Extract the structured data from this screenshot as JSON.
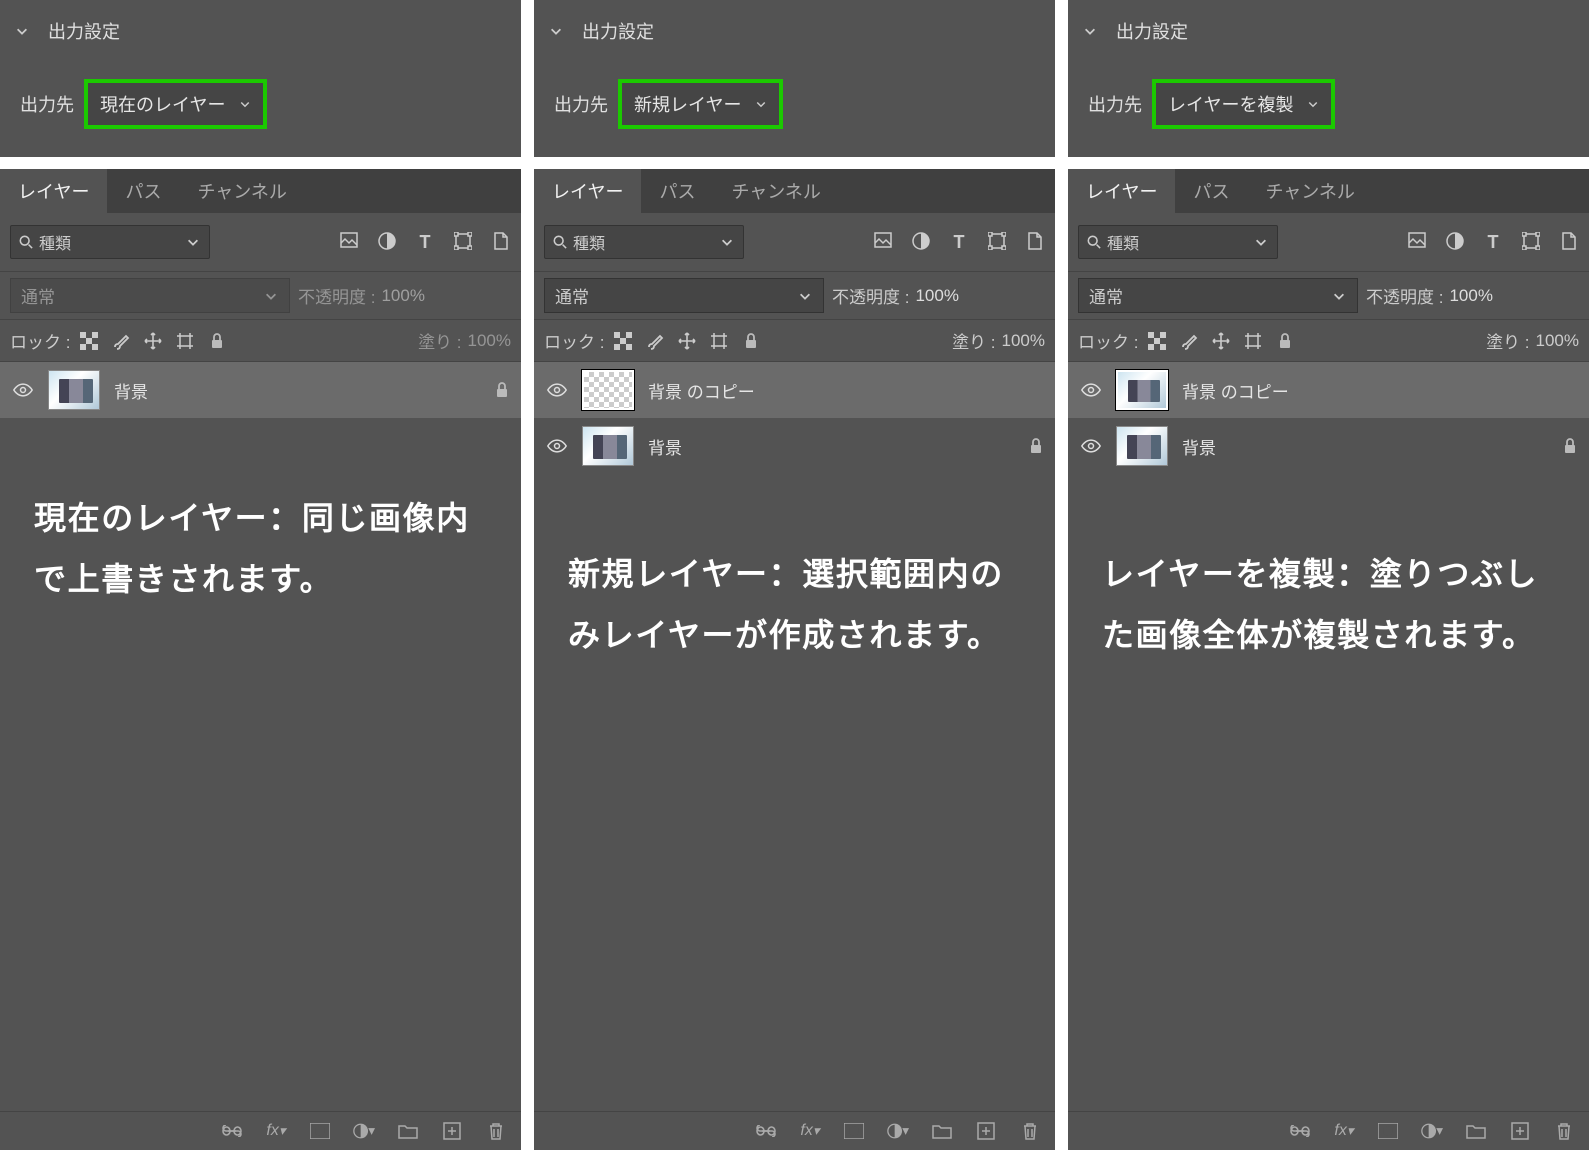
{
  "columns": [
    {
      "section_title": "出力設定",
      "output_label": "出力先",
      "output_value": "現在のレイヤー",
      "tabs": {
        "layers": "レイヤー",
        "paths": "パス",
        "channels": "チャンネル"
      },
      "filter_label": "種類",
      "blend_mode": "通常",
      "blend_disabled": true,
      "opacity_label": "不透明度 :",
      "opacity_value": "100%",
      "opacity_disabled": true,
      "lock_label": "ロック :",
      "fill_label": "塗り :",
      "fill_value": "100%",
      "fill_disabled": true,
      "layers_list": [
        {
          "name": "背景",
          "selected": true,
          "thumb": "img",
          "bracket": false,
          "locked": true
        }
      ],
      "description": "現在のレイヤー：同じ画像内で上書きされます。"
    },
    {
      "section_title": "出力設定",
      "output_label": "出力先",
      "output_value": "新規レイヤー",
      "tabs": {
        "layers": "レイヤー",
        "paths": "パス",
        "channels": "チャンネル"
      },
      "filter_label": "種類",
      "blend_mode": "通常",
      "blend_disabled": false,
      "opacity_label": "不透明度 :",
      "opacity_value": "100%",
      "opacity_disabled": false,
      "lock_label": "ロック :",
      "fill_label": "塗り :",
      "fill_value": "100%",
      "fill_disabled": false,
      "layers_list": [
        {
          "name": "背景 のコピー",
          "selected": true,
          "thumb": "trans",
          "bracket": true,
          "locked": false
        },
        {
          "name": "背景",
          "selected": false,
          "thumb": "img",
          "bracket": false,
          "locked": true
        }
      ],
      "description": "新規レイヤー：選択範囲内のみレイヤーが作成されます。"
    },
    {
      "section_title": "出力設定",
      "output_label": "出力先",
      "output_value": "レイヤーを複製",
      "tabs": {
        "layers": "レイヤー",
        "paths": "パス",
        "channels": "チャンネル"
      },
      "filter_label": "種類",
      "blend_mode": "通常",
      "blend_disabled": false,
      "opacity_label": "不透明度 :",
      "opacity_value": "100%",
      "opacity_disabled": false,
      "lock_label": "ロック :",
      "fill_label": "塗り :",
      "fill_value": "100%",
      "fill_disabled": false,
      "layers_list": [
        {
          "name": "背景 のコピー",
          "selected": true,
          "thumb": "img",
          "bracket": true,
          "locked": false
        },
        {
          "name": "背景",
          "selected": false,
          "thumb": "img",
          "bracket": false,
          "locked": true
        }
      ],
      "description": "レイヤーを複製：塗りつぶした画像全体が複製されます。"
    }
  ]
}
